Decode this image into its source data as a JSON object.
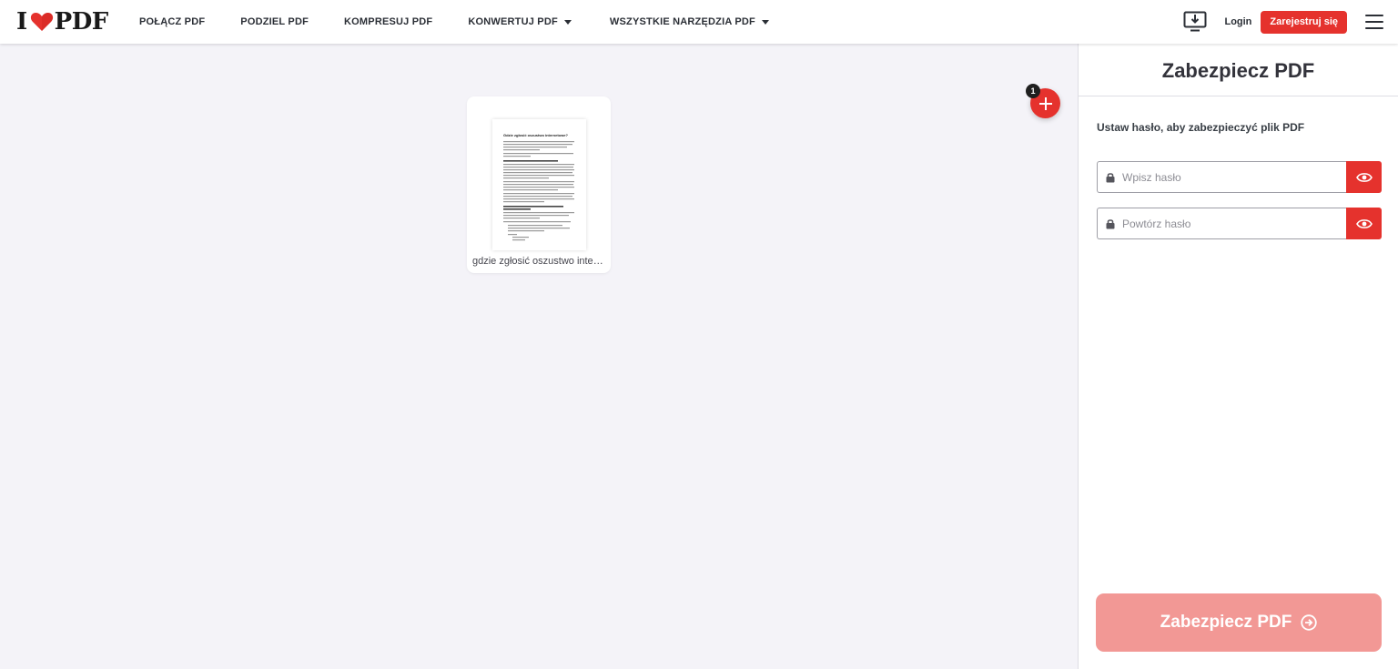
{
  "header": {
    "logo_left": "I",
    "logo_right": "PDF",
    "nav": [
      {
        "label": "POŁĄCZ PDF"
      },
      {
        "label": "PODZIEL PDF"
      },
      {
        "label": "KOMPRESUJ PDF"
      },
      {
        "label": "KONWERTUJ PDF"
      },
      {
        "label": "WSZYSTKIE NARZĘDZIA PDF"
      }
    ],
    "login": "Login",
    "signup": "Zarejestruj się",
    "icons": [
      "desktop-download-icon",
      "hamburger-menu-icon"
    ]
  },
  "workspace": {
    "file_count": "1",
    "file": {
      "name": "gdzie zgłosić oszustwo internetowe.pdf",
      "thumb_title": "Gdzie zgłosić oszustwo internetowe?"
    }
  },
  "sidebar": {
    "title": "Zabezpiecz PDF",
    "instruction": "Ustaw hasło, aby zabezpieczyć plik PDF",
    "password_placeholder": "Wpisz hasło",
    "repeat_placeholder": "Powtórz hasło",
    "submit": "Zabezpiecz PDF"
  },
  "colors": {
    "brand_red": "#e5322d",
    "submit_disabled": "#f29895",
    "workspace_bg": "#f4f3f8"
  }
}
